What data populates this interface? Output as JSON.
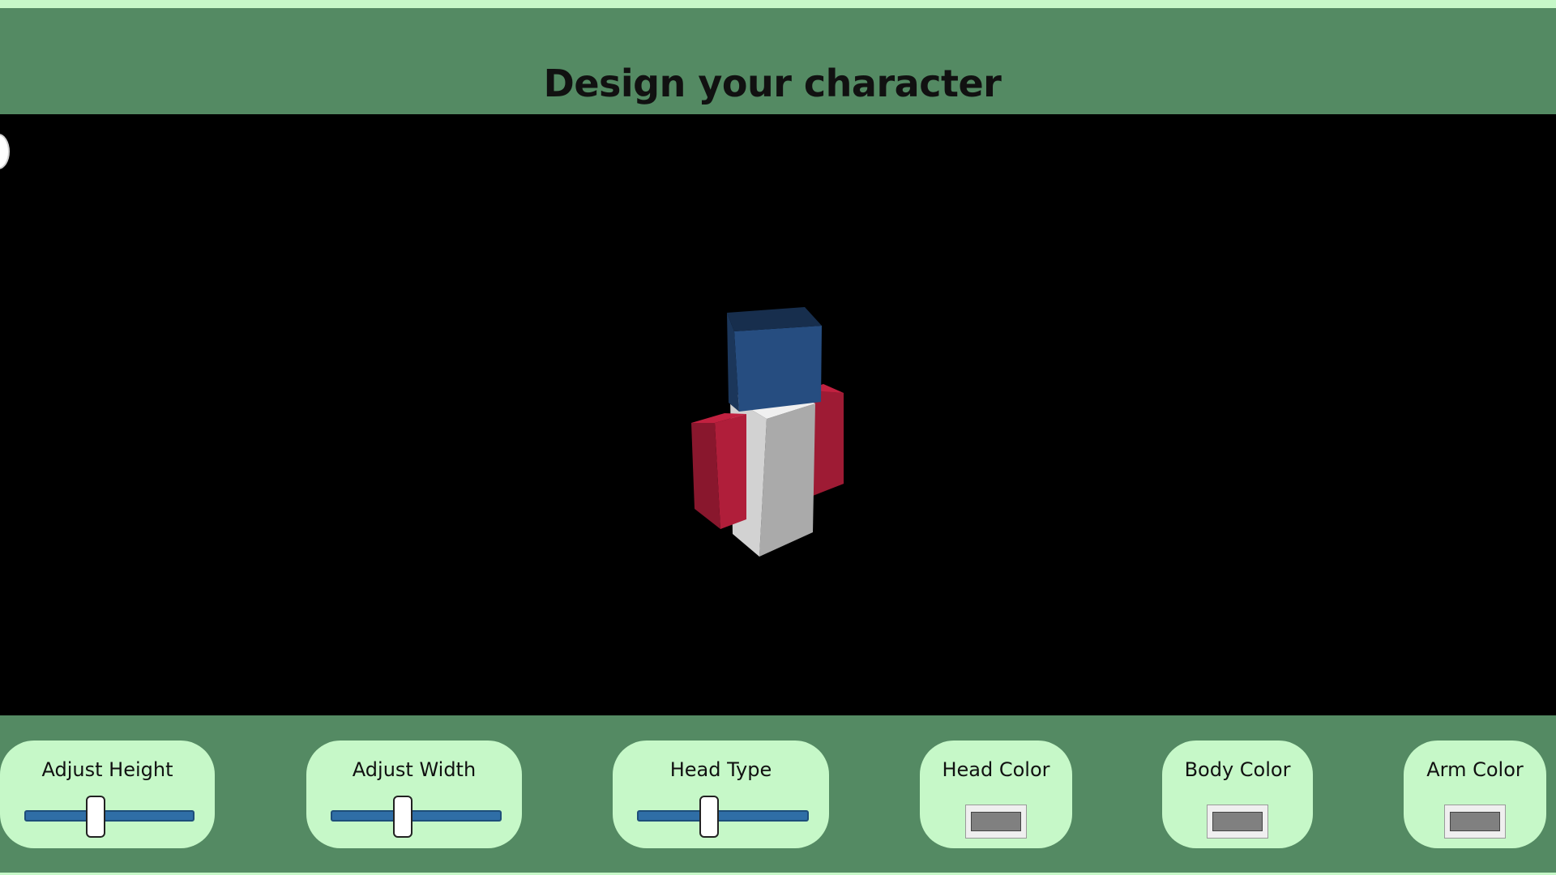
{
  "header": {
    "title": "Design your character"
  },
  "scene": {
    "head_color": "#264d80",
    "body_color": "#c8c8c8",
    "arm_color": "#b01e3a"
  },
  "controls": {
    "height": {
      "label": "Adjust Height",
      "value": 0.42
    },
    "width": {
      "label": "Adjust Width",
      "value": 0.42
    },
    "head_type": {
      "label": "Head Type",
      "value": 0.42
    },
    "head_color": {
      "label": "Head Color",
      "value": "#808080"
    },
    "body_color": {
      "label": "Body Color",
      "value": "#808080"
    },
    "arm_color": {
      "label": "Arm Color",
      "value": "#808080"
    }
  }
}
